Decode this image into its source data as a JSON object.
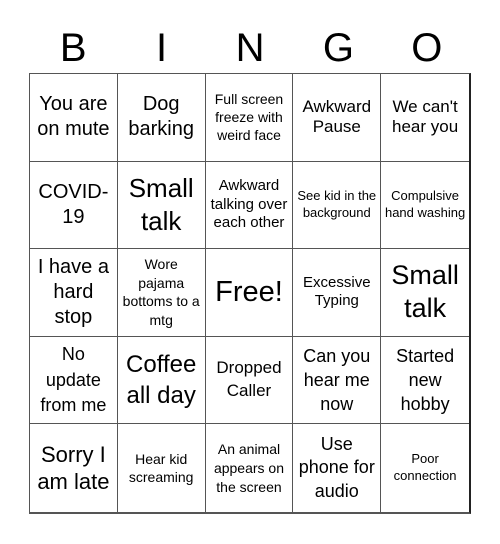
{
  "header": {
    "letters": [
      "B",
      "I",
      "N",
      "G",
      "O"
    ]
  },
  "cells": [
    {
      "text": "You are on mute"
    },
    {
      "text": "Dog barking"
    },
    {
      "text": "Full screen freeze with weird face"
    },
    {
      "text": "Awkward Pause"
    },
    {
      "text": "We can't hear you"
    },
    {
      "text": "COVID-19"
    },
    {
      "text": "Small talk"
    },
    {
      "text": "Awkward talking over each other"
    },
    {
      "text": "See kid in the background"
    },
    {
      "text": "Compulsive hand washing"
    },
    {
      "text": "I have a hard stop"
    },
    {
      "text": "Wore pajama bottoms to a mtg"
    },
    {
      "text": "Free!"
    },
    {
      "text": "Excessive Typing"
    },
    {
      "text": "Small talk"
    },
    {
      "text": "No update from me"
    },
    {
      "text": "Coffee all day"
    },
    {
      "text": "Dropped Caller"
    },
    {
      "text": "Can you hear me now"
    },
    {
      "text": "Started new hobby"
    },
    {
      "text": "Sorry I am late"
    },
    {
      "text": "Hear kid screaming"
    },
    {
      "text": "An animal appears on the screen"
    },
    {
      "text": "Use phone for audio"
    },
    {
      "text": "Poor connection"
    }
  ]
}
